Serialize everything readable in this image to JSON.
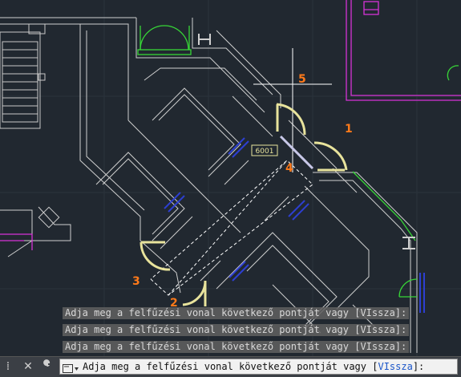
{
  "drawing": {
    "annotation_labels": [
      "1",
      "2",
      "3",
      "4",
      "5"
    ],
    "door_tag": "6001",
    "colors": {
      "background": "#212830",
      "walls": "#d6d6d6",
      "selected": "#e8e39c",
      "callout": "#ff7a1a",
      "green_layer": "#37d637",
      "magenta_layer": "#d633d6",
      "blue_layer": "#2d3fd1",
      "crosshair": "#ffffff"
    }
  },
  "command_history": [
    "Adja meg a felfűzési vonal következő pontját vagy [VIssza]:",
    "Adja meg a felfűzési vonal következő pontját vagy [VIssza]:",
    "Adja meg a felfűzési vonal következő pontját vagy [VIssza]:"
  ],
  "command_line": {
    "prompt_prefix": "Adja meg a felfűzési vonal következő pontját vagy [",
    "prompt_keyword": "VIssza",
    "prompt_suffix": "]:",
    "icons": [
      "grip-icon",
      "close-icon",
      "wrench-icon",
      "command-icon"
    ]
  }
}
